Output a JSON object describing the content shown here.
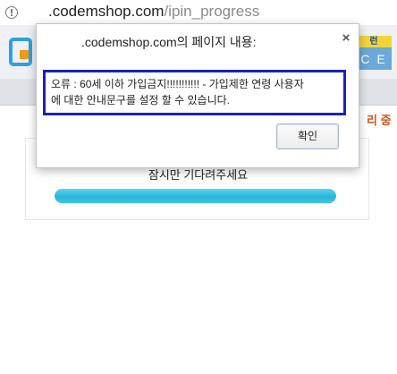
{
  "browser": {
    "url_host": ".codemshop.com",
    "url_path": "/ipin_progress",
    "url_icon": "info-icon"
  },
  "page": {
    "side_text": "리 중",
    "wait_text": "잠시만 기다려주세요",
    "progress_fraction": 1.0,
    "badge_top": "런",
    "badge_bottom": "C E"
  },
  "dialog": {
    "title": ".codemshop.com의 페이지 내용:",
    "close_label": "×",
    "message_lines": [
      "오류 : 60세 이하 가입금지!!!!!!!!!!! - 가입제한 연령 사용자",
      "에 대한 안내문구를 설정 할 수 있습니다."
    ],
    "ok_label": "확인"
  },
  "colors": {
    "message_border": "#1a22b5",
    "progress": "#2ab4d8",
    "side_text": "#d2521c"
  }
}
